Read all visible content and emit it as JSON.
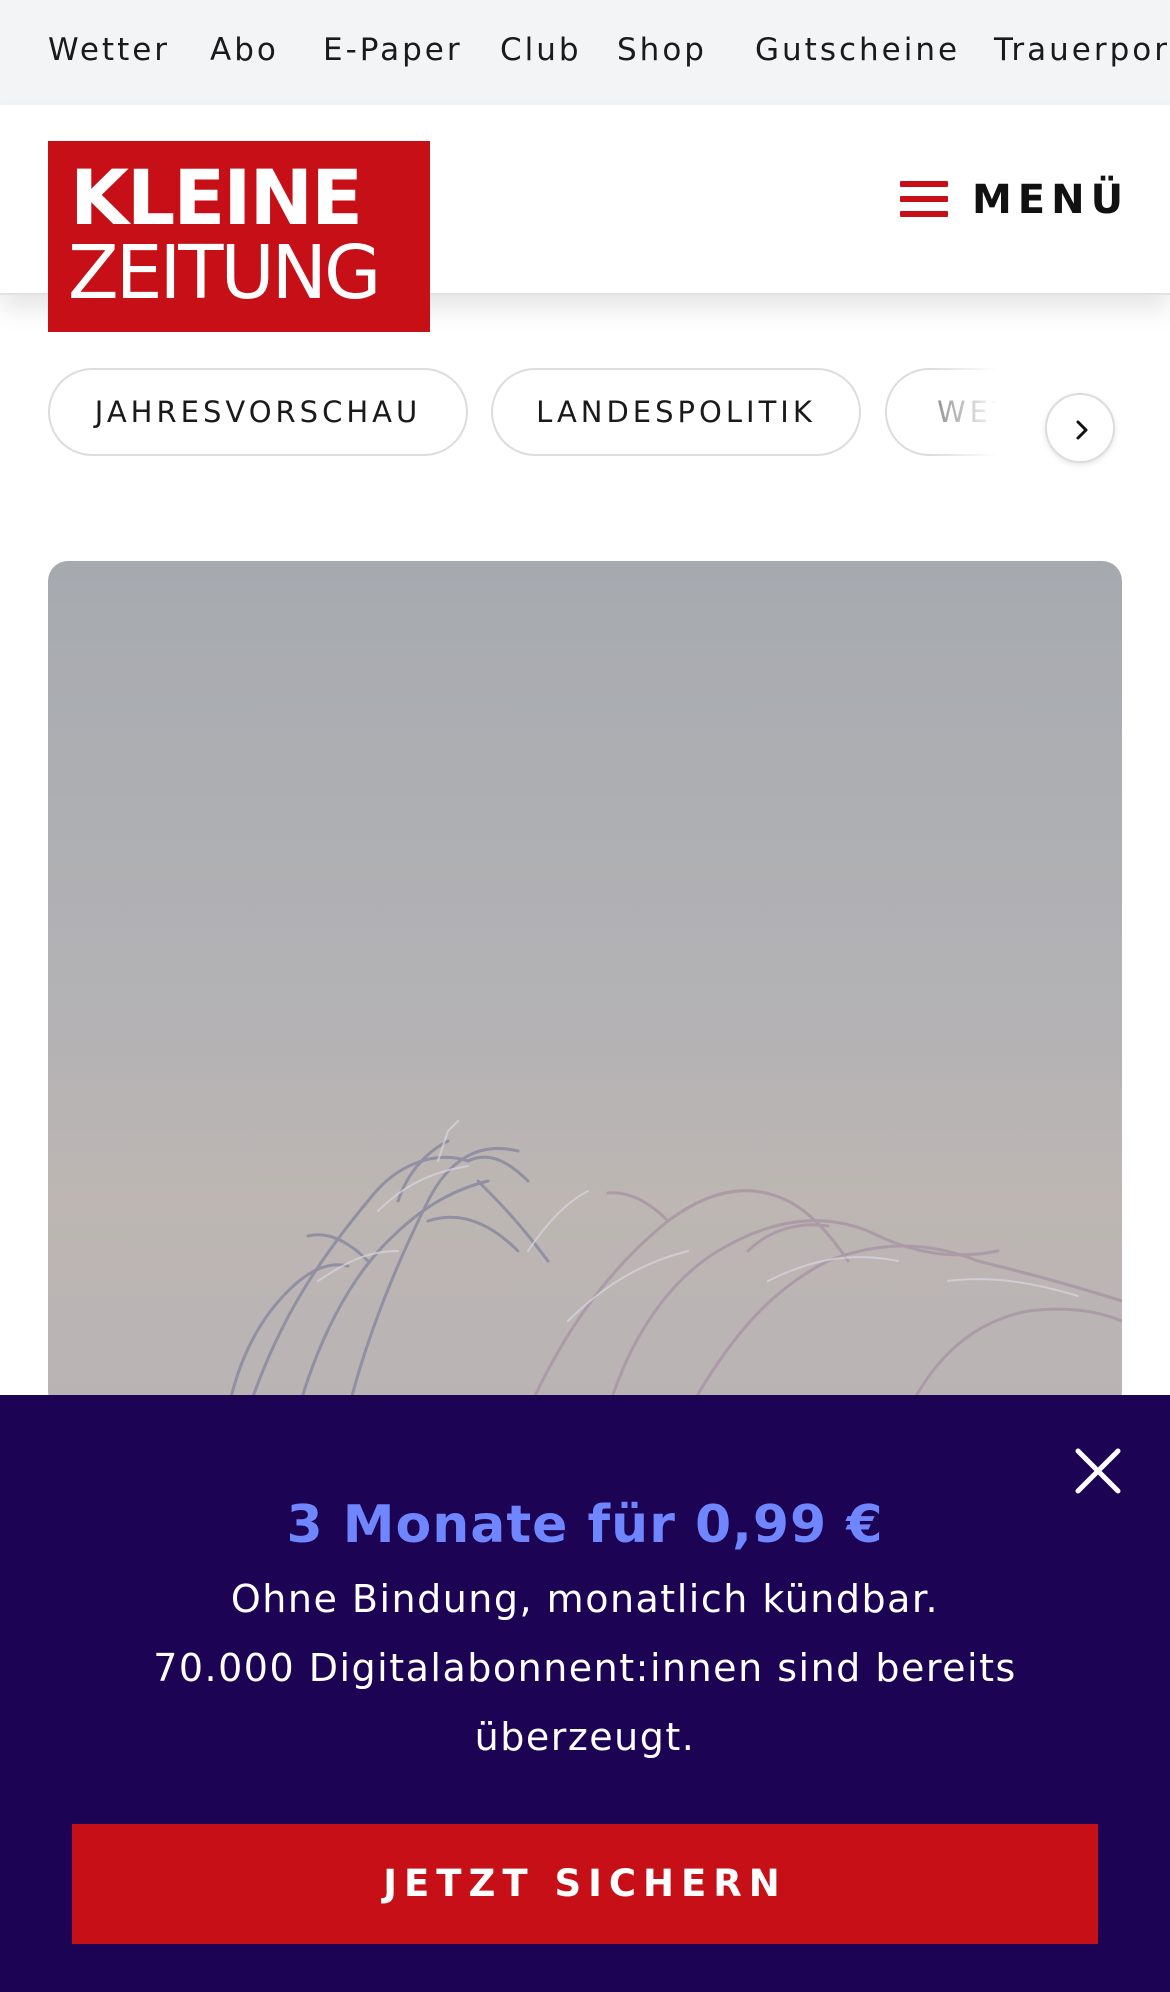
{
  "topnav": {
    "items": [
      "Wetter",
      "Abo",
      "E-Paper",
      "Club",
      "Shop",
      "Gutscheine",
      "Trauerportal"
    ]
  },
  "header": {
    "logo_line1": "KLEINE",
    "logo_line2": "ZEITUNG",
    "menu_label": "MENÜ",
    "brand_color": "#c60f16"
  },
  "chips": {
    "items": [
      "JAHRESVORSCHAU",
      "LANDESPOLITIK",
      "WETTER"
    ],
    "next_icon": "chevron-right-icon"
  },
  "promo": {
    "title": "3 Monate für 0,99 €",
    "line1": "Ohne Bindung, monatlich kündbar.",
    "line2": "70.000 Digitalabonnent:innen sind bereits überzeugt.",
    "cta_label": "JETZT SICHERN",
    "close_icon": "close-icon",
    "background_color": "#1c0354",
    "title_color": "#6f86ff"
  }
}
